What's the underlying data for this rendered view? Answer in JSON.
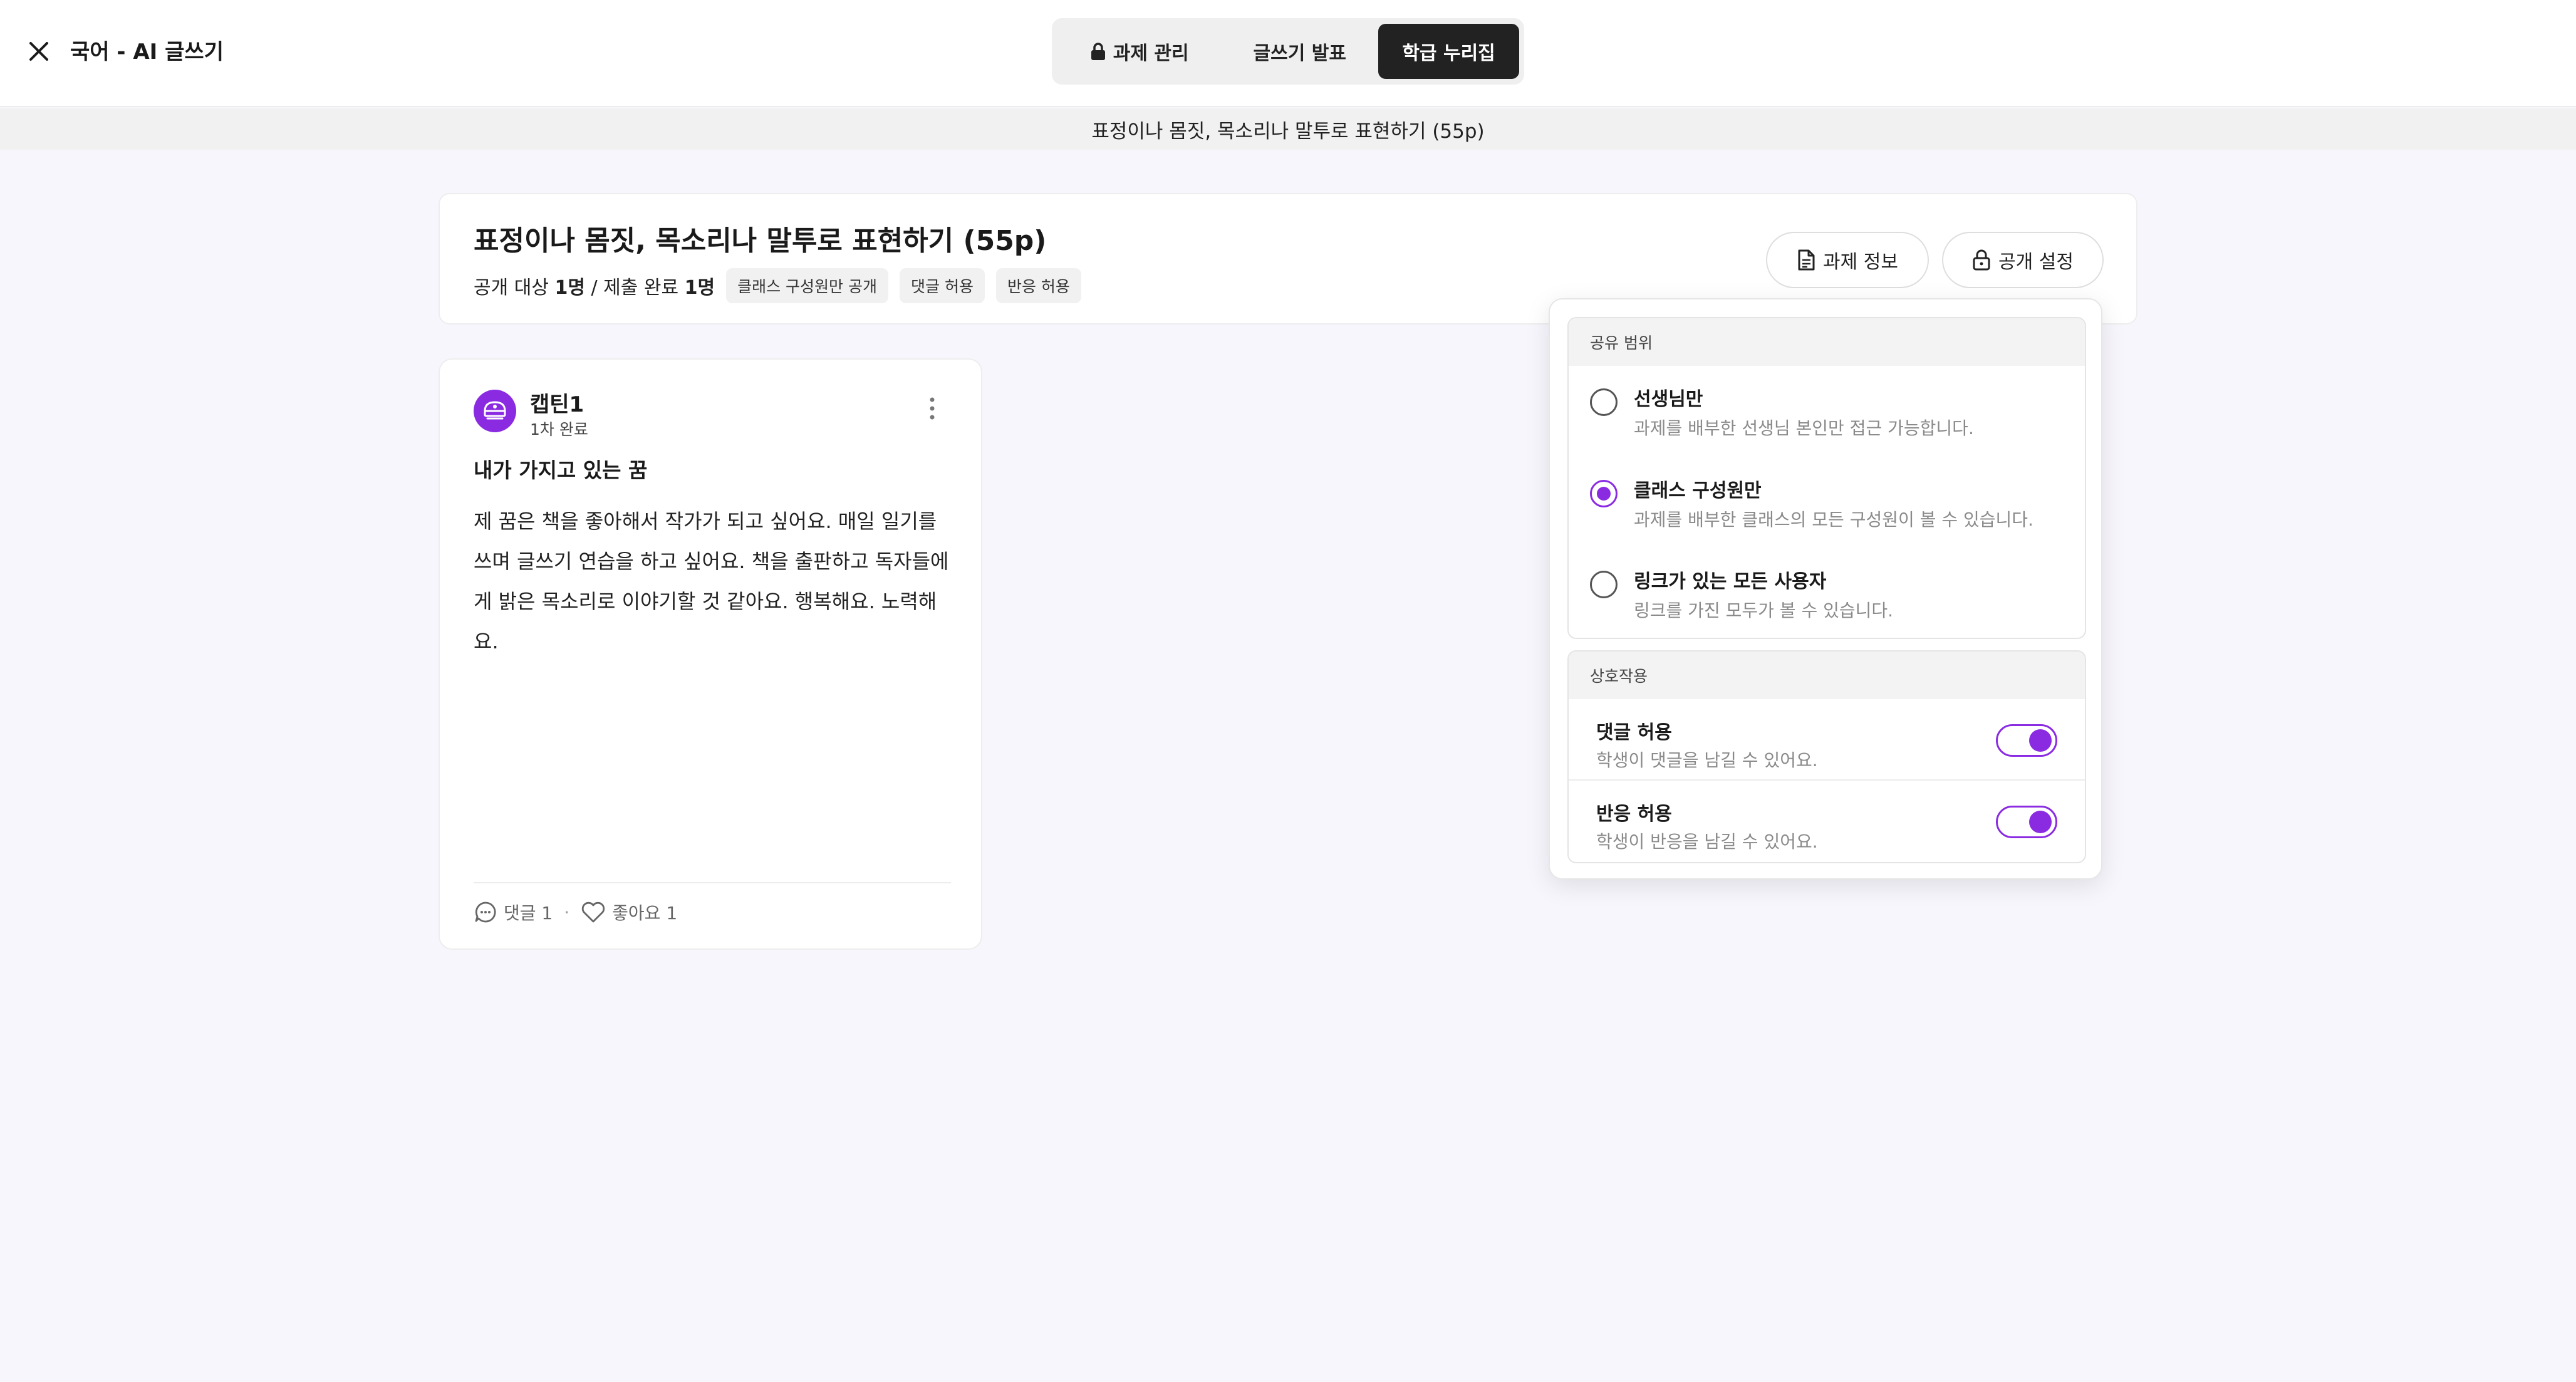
{
  "header": {
    "app_title": "국어 - AI 글쓰기",
    "tabs": [
      {
        "label": "과제 관리",
        "icon": "lock-icon",
        "active": false
      },
      {
        "label": "글쓰기 발표",
        "active": false
      },
      {
        "label": "학급 누리집",
        "active": true
      }
    ]
  },
  "subheader": {
    "title": "표정이나 몸짓, 목소리나 말투로 표현하기 (55p)"
  },
  "assignment": {
    "title": "표정이나 몸짓, 목소리나 말투로 표현하기 (55p)",
    "meta_prefix": "공개 대상 ",
    "target_count": "1명",
    "meta_sep": " / 제출 완료 ",
    "submitted_count": "1명",
    "chips": [
      "클래스 구성원만 공개",
      "댓글 허용",
      "반응 허용"
    ],
    "info_button": "과제 정보",
    "visibility_button": "공개 설정"
  },
  "post": {
    "author": "캡틴1",
    "status": "1차 완료",
    "title": "내가 가지고 있는 꿈",
    "body": "제 꿈은 책을 좋아해서 작가가 되고 싶어요. 매일 일기를 쓰며 글쓰기 연습을 하고 싶어요. 책을 출판하고 독자들에게 밝은 목소리로 이야기할 것 같아요. 행복해요. 노력해요.",
    "comments_label": "댓글 1",
    "likes_label": "좋아요 1"
  },
  "visibility_popover": {
    "scope_header": "공유 범위",
    "options": [
      {
        "title": "선생님만",
        "desc": "과제를 배부한 선생님 본인만 접근 가능합니다.",
        "selected": false
      },
      {
        "title": "클래스 구성원만",
        "desc": "과제를 배부한 클래스의 모든 구성원이 볼 수 있습니다.",
        "selected": true
      },
      {
        "title": "링크가 있는 모든 사용자",
        "desc": "링크를 가진 모두가 볼 수 있습니다.",
        "selected": false
      }
    ],
    "interaction_header": "상호작용",
    "toggles": [
      {
        "title": "댓글 허용",
        "desc": "학생이 댓글을 남길 수 있어요.",
        "on": true
      },
      {
        "title": "반응 허용",
        "desc": "학생이 반응을 남길 수 있어요.",
        "on": true
      }
    ]
  },
  "colors": {
    "accent": "#8a2be2",
    "active_tab": "#222222",
    "background": "#f8f6fd"
  }
}
